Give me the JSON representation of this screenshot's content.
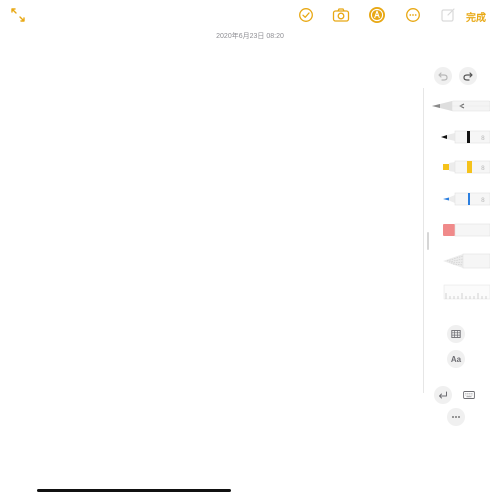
{
  "toolbar": {
    "done_label": "完成",
    "accent_color": "#e8a814"
  },
  "note": {
    "timestamp": "2020年6月23日 08:20"
  },
  "tools": {
    "text_format_label": "Aa",
    "pen_colors": [
      "#111111",
      "#f5c21b",
      "#2b7fe0"
    ],
    "eraser_color": "#f08a8a"
  }
}
